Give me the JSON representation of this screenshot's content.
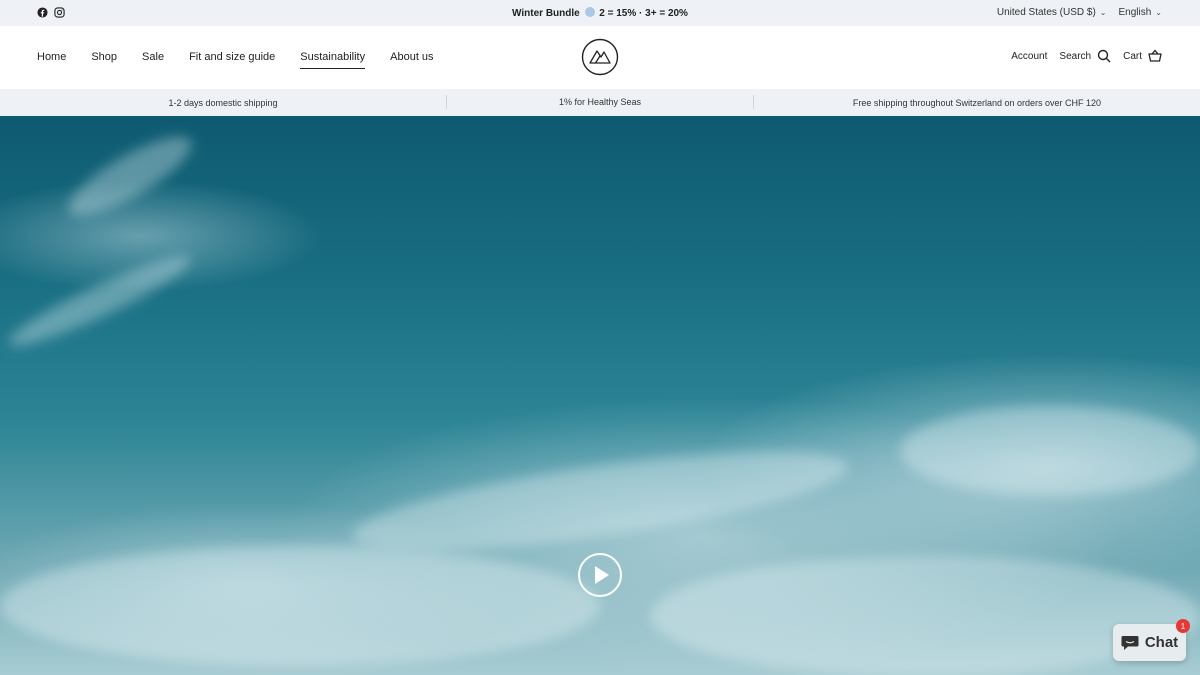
{
  "announcement": {
    "prefix": "Winter Bundle",
    "offer": "2 = 15% · 3+ = 20%",
    "country": "United States (USD $)",
    "language": "English"
  },
  "nav": {
    "items": [
      "Home",
      "Shop",
      "Sale",
      "Fit and size guide",
      "Sustainability",
      "About us"
    ],
    "active": "Sustainability"
  },
  "header": {
    "account": "Account",
    "search": "Search",
    "cart": "Cart"
  },
  "strip": {
    "shipping": "1-2 days domestic shipping",
    "seas": "1% for Healthy Seas",
    "free": "Free shipping throughout Switzerland on orders over CHF 120"
  },
  "chat": {
    "label": "Chat",
    "badge": "1"
  },
  "icons": [
    "facebook-icon",
    "instagram-icon",
    "search-icon",
    "cart-icon",
    "play-icon",
    "chat-icon",
    "chevron-down-icon"
  ],
  "colors": {
    "bar_bg": "#eef1f5",
    "badge": "#e53935"
  }
}
